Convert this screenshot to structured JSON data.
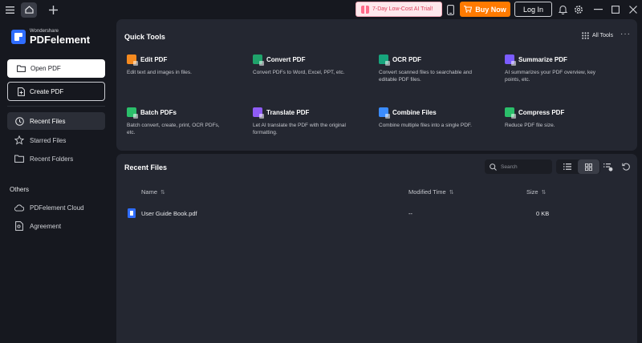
{
  "titlebar": {
    "promo": "7-Day Low-Cost AI Trial!",
    "buy_now": "Buy Now",
    "login": "Log In"
  },
  "brand": {
    "small": "Wondershare",
    "name": "PDFelement"
  },
  "sidebar": {
    "open_pdf": "Open PDF",
    "create_pdf": "Create PDF",
    "items": [
      {
        "label": "Recent Files"
      },
      {
        "label": "Starred Files"
      },
      {
        "label": "Recent Folders"
      }
    ],
    "others_label": "Others",
    "others": [
      {
        "label": "PDFelement Cloud"
      },
      {
        "label": "Agreement"
      }
    ]
  },
  "quick_tools": {
    "title": "Quick Tools",
    "all_tools": "All Tools",
    "tools": [
      {
        "name": "Edit PDF",
        "desc": "Edit text and images in files.",
        "color": "#f58a1f"
      },
      {
        "name": "Convert PDF",
        "desc": "Convert PDFs to Word, Excel, PPT, etc.",
        "color": "#1fa36b"
      },
      {
        "name": "OCR PDF",
        "desc": "Convert scanned files to searchable and editable PDF files.",
        "color": "#17a57d"
      },
      {
        "name": "Summarize PDF",
        "desc": "AI summarizes your PDF overview, key points, etc.",
        "color": "#7b5cff"
      },
      {
        "name": "Batch PDFs",
        "desc": "Batch convert, create, print, OCR PDFs, etc.",
        "color": "#2bbf6a"
      },
      {
        "name": "Translate PDF",
        "desc": "Let AI translate the PDF with the original formatting.",
        "color": "#8f5cf5"
      },
      {
        "name": "Combine Files",
        "desc": "Combine multiple files into a single PDF.",
        "color": "#3b8cff"
      },
      {
        "name": "Compress PDF",
        "desc": "Reduce PDF file size.",
        "color": "#2bbf6a"
      }
    ]
  },
  "recent_files": {
    "title": "Recent Files",
    "search_placeholder": "Search",
    "columns": {
      "name": "Name",
      "modified": "Modified Time",
      "size": "Size"
    },
    "rows": [
      {
        "name": "User Guide Book.pdf",
        "modified": "--",
        "size": "0 KB"
      }
    ]
  }
}
